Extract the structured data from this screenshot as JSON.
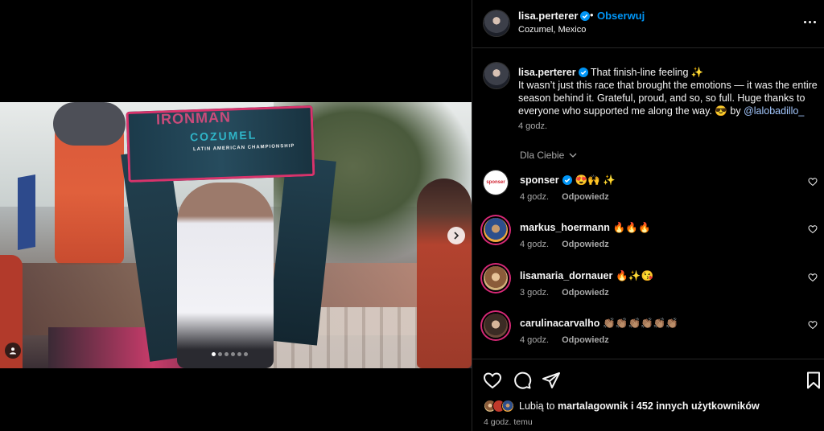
{
  "post": {
    "dots_count": 6,
    "active_dot": 0
  },
  "header": {
    "username": "lisa.perterer",
    "separator": "•",
    "follow_label": "Obserwuj",
    "location": "Cozumel, Mexico"
  },
  "caption": {
    "username": "lisa.perterer",
    "text_line1": "That finish-line feeling ✨",
    "text_body": "It wasn’t just this race that brought the emotions — it was the entire season behind it. Grateful, proud, and so, so full. Huge thanks to everyone who supported me along the way. 😎 by ",
    "mention": "@lalobadillo_",
    "time": "4 godz."
  },
  "banner": {
    "line1": "IRONMAN",
    "line2": "COZUMEL",
    "line3": "LATIN AMERICAN CHAMPIONSHIP"
  },
  "for_you_label": "Dla Ciebie",
  "comments": [
    {
      "username": "sponser",
      "verified": true,
      "text": "😍🙌 ✨",
      "time": "4 godz.",
      "reply": "Odpowiedz",
      "avatar_label": "sponser"
    },
    {
      "username": "markus_hoermann",
      "verified": false,
      "text": "🔥🔥🔥",
      "time": "4 godz.",
      "reply": "Odpowiedz"
    },
    {
      "username": "lisamaria_dornauer",
      "verified": false,
      "text": "🔥✨😘",
      "time": "3 godz.",
      "reply": "Odpowiedz"
    },
    {
      "username": "carulinacarvalho",
      "verified": false,
      "text": "👏🏽👏🏽👏🏽👏🏽👏🏽👏🏽",
      "time": "4 godz.",
      "reply": "Odpowiedz"
    }
  ],
  "likes": {
    "prefix": "Lubią to ",
    "user": "martalagownik",
    "suffix": " i 452 innych użytkowników"
  },
  "posted_ago": "4 godz. temu",
  "colors": {
    "accent": "#0095f6",
    "background": "#000000",
    "muted": "#a8a8a8"
  }
}
